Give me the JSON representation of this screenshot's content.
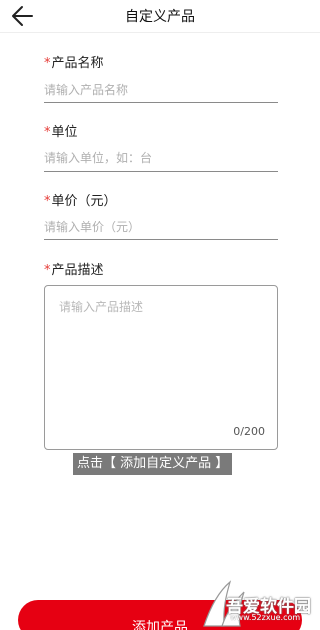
{
  "header": {
    "title": "自定义产品",
    "back_icon": "arrow-left-icon"
  },
  "form": {
    "required_mark": "*",
    "name": {
      "label": "产品名称",
      "placeholder": "请输入产品名称"
    },
    "unit": {
      "label": "单位",
      "placeholder": "请输入单位，如：台"
    },
    "price": {
      "label": "单价（元）",
      "placeholder": "请输入单价（元）"
    },
    "description": {
      "label": "产品描述",
      "placeholder": "请输入产品描述",
      "counter": "0/200"
    }
  },
  "hint": "点击【 添加自定义产品 】",
  "add_button": {
    "label": "添加产品",
    "color": "#e60012"
  },
  "watermark": {
    "title": "吾爱软件园",
    "url": "www.52zxue.com"
  },
  "colors": {
    "required": "#e53935",
    "accent": "#e60012"
  }
}
